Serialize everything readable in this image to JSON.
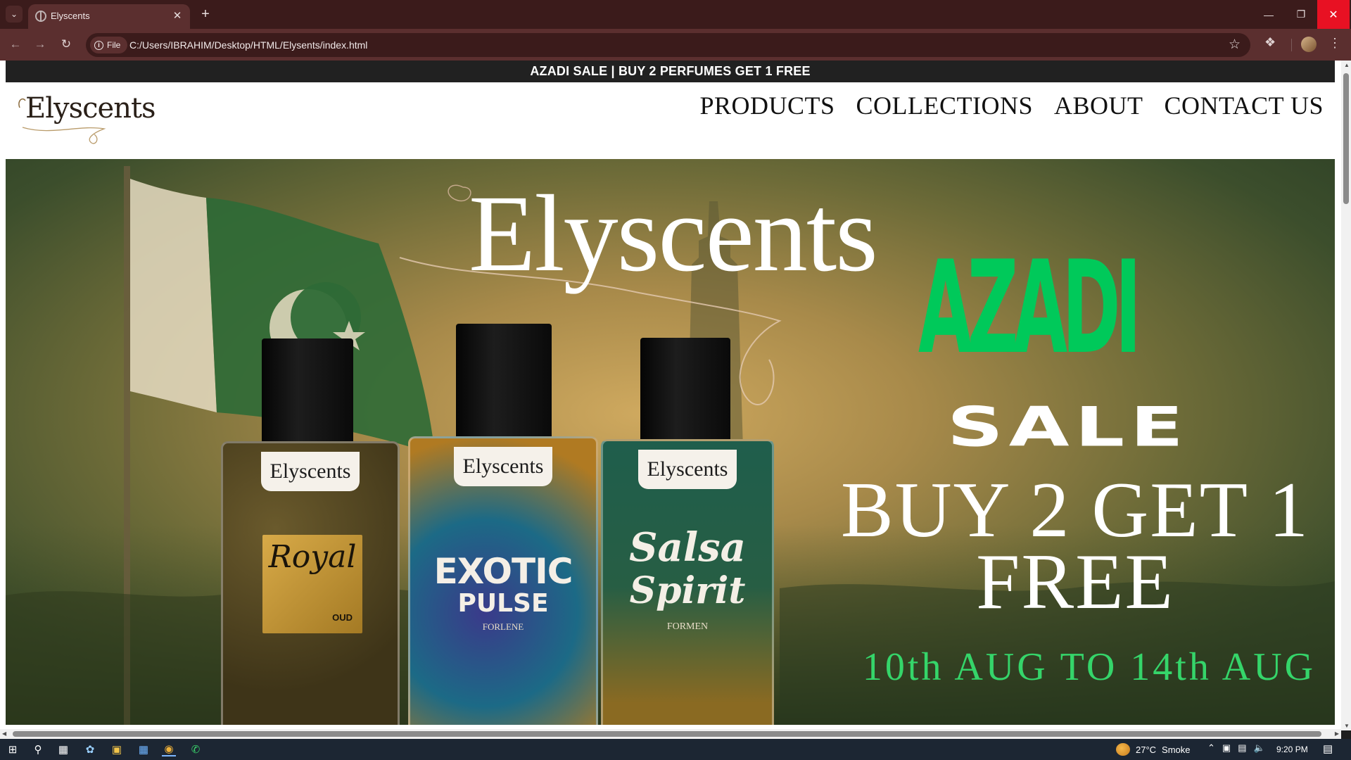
{
  "browser": {
    "tab_title": "Elyscents",
    "site_chip": "File",
    "url": "C:/Users/IBRAHIM/Desktop/HTML/Elysents/index.html"
  },
  "page": {
    "promo_bar": "AZADI SALE | BUY 2 PERFUMES GET 1 FREE",
    "logo_text": "Elyscents",
    "nav": [
      "PRODUCTS",
      "COLLECTIONS",
      "ABOUT",
      "CONTACT US"
    ],
    "hero": {
      "brand": "Elyscents",
      "azadi": "AZADI",
      "sale": "SALE",
      "offer_line1": "BUY 2 GET 1",
      "offer_line2": "FREE",
      "dates": "10th AUG TO 14th AUG",
      "bottles": [
        {
          "label": "Elyscents",
          "name": "Royal",
          "sub": "OUD"
        },
        {
          "label": "Elyscents",
          "name": "EXOTIC",
          "name2": "PULSE",
          "sub": "FORLENE"
        },
        {
          "label": "Elyscents",
          "name": "Salsa",
          "name2": "Spirit",
          "sub": "FORMEN"
        }
      ]
    }
  },
  "taskbar": {
    "weather_temp": "27°C",
    "weather_text": "Smoke",
    "time": "9:20 PM"
  },
  "colors": {
    "browser_frame": "#3b1b1b",
    "toolbar": "#5b2f2f",
    "promo_bg": "#212121",
    "azadi_green": "#00c95a",
    "date_green": "#35d56a",
    "close_red": "#e81123"
  }
}
